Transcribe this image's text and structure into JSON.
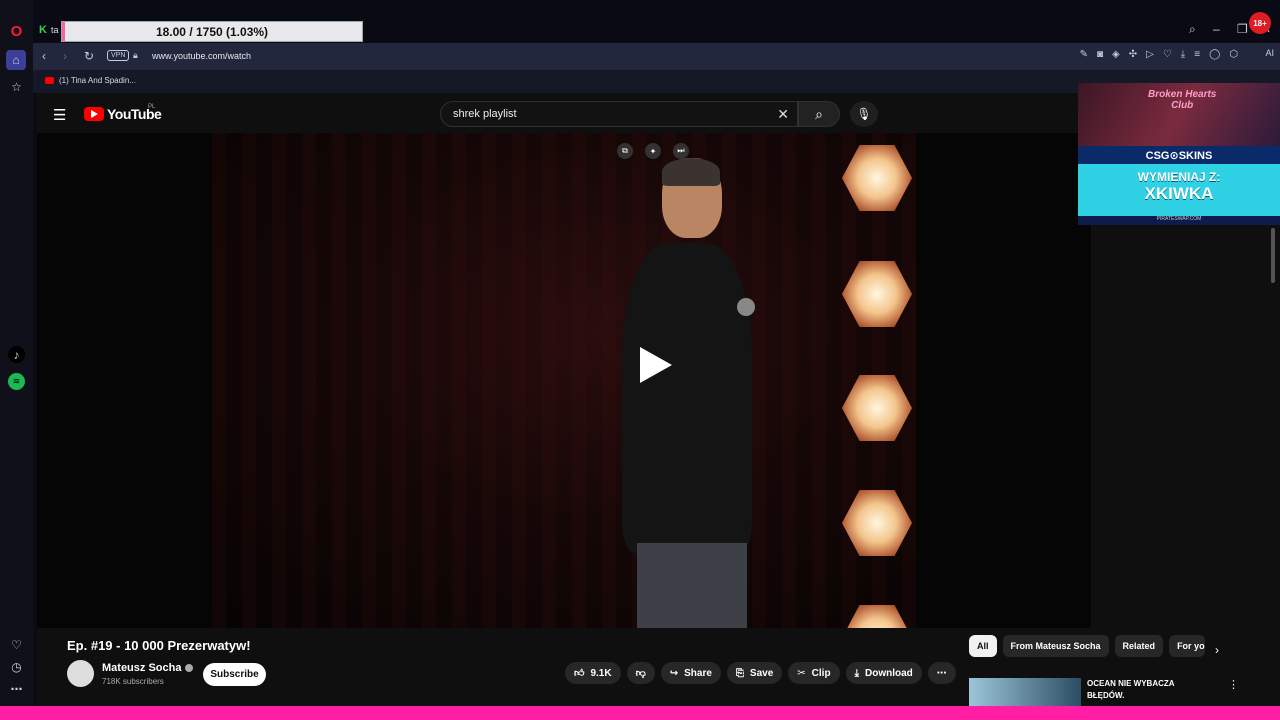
{
  "browser": {
    "tab_title": "ta",
    "progress_text": "18.00 / 1750 (1.03%)",
    "progress_fraction": 0.0103,
    "badge": "18+",
    "url": "www.youtube.com/watch",
    "vpn_label": "VPN",
    "ai_label": "AI",
    "bookmark_label": "(1) Tina And Spadin..."
  },
  "youtube": {
    "logo_text": "YouTube",
    "country": "PL",
    "search_value": "shrek playlist",
    "video_title": "Ep. #19 - 10 000 Prezerwatyw!",
    "channel_name": "Mateusz Socha",
    "subscribers": "718K subscribers",
    "subscribe_label": "Subscribe",
    "like_count": "9.1K",
    "share_label": "Share",
    "save_label": "Save",
    "clip_label": "Clip",
    "download_label": "Download",
    "chips": [
      "All",
      "From Mateusz Socha",
      "Related",
      "For you"
    ],
    "rec_title_1": "OCEAN NIE WYBACZA",
    "rec_title_2": "BŁĘDÓW."
  },
  "ad": {
    "art_title_1": "Broken Hearts",
    "art_title_2": "Club",
    "brand": "CSG⊙SKINS",
    "cta_1": "WYMIENIAJ Z:",
    "cta_2": "XKIWKA",
    "footer": "PIRATESWAP.COM"
  },
  "colors": {
    "accent_pink": "#ff1ea4",
    "youtube_red": "#ff0000",
    "ad_cyan": "#2fd1e4"
  }
}
